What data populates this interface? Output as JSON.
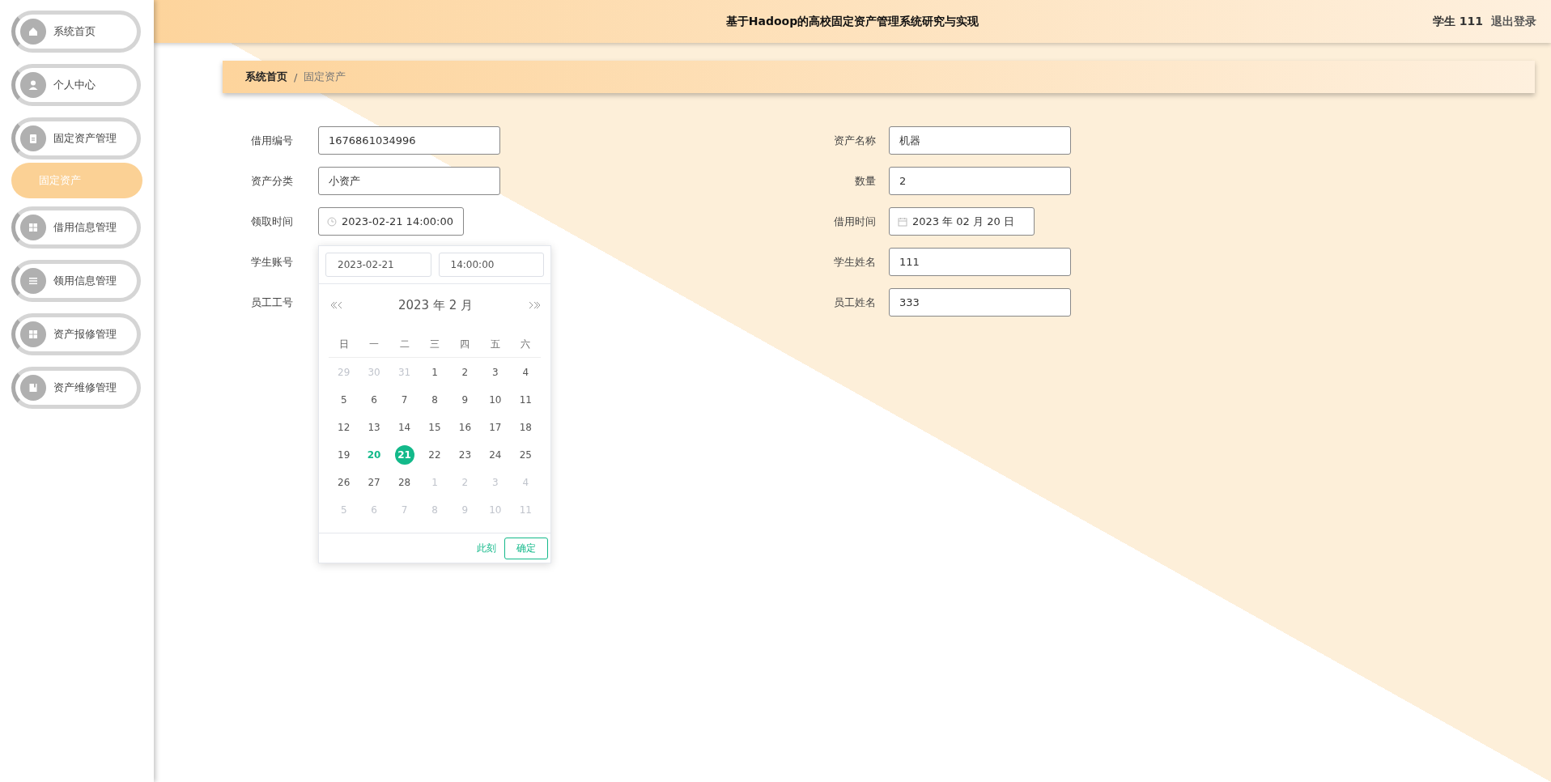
{
  "header": {
    "title": "基于Hadoop的高校固定资产管理系统研究与实现",
    "user": "学生 111",
    "logout": "退出登录"
  },
  "sidebar": {
    "items": [
      {
        "label": "系统首页",
        "kind": "menu",
        "selected": false
      },
      {
        "label": "个人中心",
        "kind": "menu",
        "selected": false
      },
      {
        "label": "固定资产管理",
        "kind": "menu",
        "selected": false
      },
      {
        "label": "固定资产",
        "kind": "submenu",
        "selected": true
      },
      {
        "label": "借用信息管理",
        "kind": "menu",
        "selected": false
      },
      {
        "label": "领用信息管理",
        "kind": "menu",
        "selected": false
      },
      {
        "label": "资产报修管理",
        "kind": "menu",
        "selected": false
      },
      {
        "label": "资产维修管理",
        "kind": "menu",
        "selected": false
      }
    ]
  },
  "breadcrumb": {
    "separator": "/",
    "items": [
      "系统首页",
      "固定资产"
    ]
  },
  "form": {
    "left": [
      {
        "label": "借用编号",
        "kind": "text",
        "value": "1676861034996"
      },
      {
        "label": "资产分类",
        "kind": "text",
        "value": "小资产"
      },
      {
        "label": "领取时间",
        "kind": "datetime",
        "value": "2023-02-21 14:00:00"
      },
      {
        "label": "学生账号",
        "kind": "hidden"
      },
      {
        "label": "员工工号",
        "kind": "hidden"
      }
    ],
    "right": [
      {
        "label": "资产名称",
        "kind": "text",
        "value": "机器"
      },
      {
        "label": "数量",
        "kind": "text",
        "value": "2"
      },
      {
        "label": "借用时间",
        "kind": "date",
        "value": "2023 年 02 月 20 日"
      },
      {
        "label": "学生姓名",
        "kind": "text",
        "value": "111"
      },
      {
        "label": "员工姓名",
        "kind": "text",
        "value": "333"
      }
    ]
  },
  "picker": {
    "date_input": "2023-02-21",
    "time_input": "14:00:00",
    "title": "2023 年  2 月",
    "weekdays": [
      "日",
      "一",
      "二",
      "三",
      "四",
      "五",
      "六"
    ],
    "days": [
      {
        "day": "29",
        "muted": true,
        "today": false,
        "selected": false
      },
      {
        "day": "30",
        "muted": true,
        "today": false,
        "selected": false
      },
      {
        "day": "31",
        "muted": true,
        "today": false,
        "selected": false
      },
      {
        "day": "1",
        "muted": false,
        "today": false,
        "selected": false
      },
      {
        "day": "2",
        "muted": false,
        "today": false,
        "selected": false
      },
      {
        "day": "3",
        "muted": false,
        "today": false,
        "selected": false
      },
      {
        "day": "4",
        "muted": false,
        "today": false,
        "selected": false
      },
      {
        "day": "5",
        "muted": false,
        "today": false,
        "selected": false
      },
      {
        "day": "6",
        "muted": false,
        "today": false,
        "selected": false
      },
      {
        "day": "7",
        "muted": false,
        "today": false,
        "selected": false
      },
      {
        "day": "8",
        "muted": false,
        "today": false,
        "selected": false
      },
      {
        "day": "9",
        "muted": false,
        "today": false,
        "selected": false
      },
      {
        "day": "10",
        "muted": false,
        "today": false,
        "selected": false
      },
      {
        "day": "11",
        "muted": false,
        "today": false,
        "selected": false
      },
      {
        "day": "12",
        "muted": false,
        "today": false,
        "selected": false
      },
      {
        "day": "13",
        "muted": false,
        "today": false,
        "selected": false
      },
      {
        "day": "14",
        "muted": false,
        "today": false,
        "selected": false
      },
      {
        "day": "15",
        "muted": false,
        "today": false,
        "selected": false
      },
      {
        "day": "16",
        "muted": false,
        "today": false,
        "selected": false
      },
      {
        "day": "17",
        "muted": false,
        "today": false,
        "selected": false
      },
      {
        "day": "18",
        "muted": false,
        "today": false,
        "selected": false
      },
      {
        "day": "19",
        "muted": false,
        "today": false,
        "selected": false
      },
      {
        "day": "20",
        "muted": false,
        "today": true,
        "selected": false
      },
      {
        "day": "21",
        "muted": false,
        "today": false,
        "selected": true
      },
      {
        "day": "22",
        "muted": false,
        "today": false,
        "selected": false
      },
      {
        "day": "23",
        "muted": false,
        "today": false,
        "selected": false
      },
      {
        "day": "24",
        "muted": false,
        "today": false,
        "selected": false
      },
      {
        "day": "25",
        "muted": false,
        "today": false,
        "selected": false
      },
      {
        "day": "26",
        "muted": false,
        "today": false,
        "selected": false
      },
      {
        "day": "27",
        "muted": false,
        "today": false,
        "selected": false
      },
      {
        "day": "28",
        "muted": false,
        "today": false,
        "selected": false
      },
      {
        "day": "1",
        "muted": true,
        "today": false,
        "selected": false
      },
      {
        "day": "2",
        "muted": true,
        "today": false,
        "selected": false
      },
      {
        "day": "3",
        "muted": true,
        "today": false,
        "selected": false
      },
      {
        "day": "4",
        "muted": true,
        "today": false,
        "selected": false
      },
      {
        "day": "5",
        "muted": true,
        "today": false,
        "selected": false
      },
      {
        "day": "6",
        "muted": true,
        "today": false,
        "selected": false
      },
      {
        "day": "7",
        "muted": true,
        "today": false,
        "selected": false
      },
      {
        "day": "8",
        "muted": true,
        "today": false,
        "selected": false
      },
      {
        "day": "9",
        "muted": true,
        "today": false,
        "selected": false
      },
      {
        "day": "10",
        "muted": true,
        "today": false,
        "selected": false
      },
      {
        "day": "11",
        "muted": true,
        "today": false,
        "selected": false
      }
    ],
    "now_link": "此刻",
    "confirm": "确定"
  }
}
